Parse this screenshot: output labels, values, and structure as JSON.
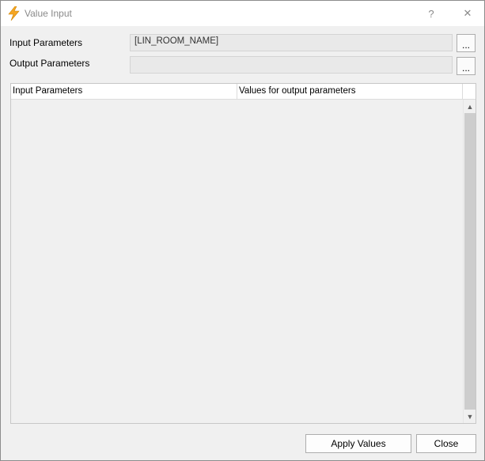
{
  "window": {
    "title": "Value Input",
    "help_label": "?",
    "close_label": "✕",
    "icon": "lightning-bolt-icon",
    "icon_color": "#f5a623"
  },
  "form": {
    "input_label": "Input Parameters",
    "input_value": "[LIN_ROOM_NAME]",
    "input_button": "...",
    "output_label": "Output Parameters",
    "output_value": "",
    "output_button": "..."
  },
  "grid": {
    "columns": [
      "Input Parameters",
      "Values for output parameters"
    ],
    "rows": [],
    "scroll_up": "▲",
    "scroll_down": "▼"
  },
  "buttons": {
    "apply_label": "Apply Values",
    "close_label": "Close"
  }
}
